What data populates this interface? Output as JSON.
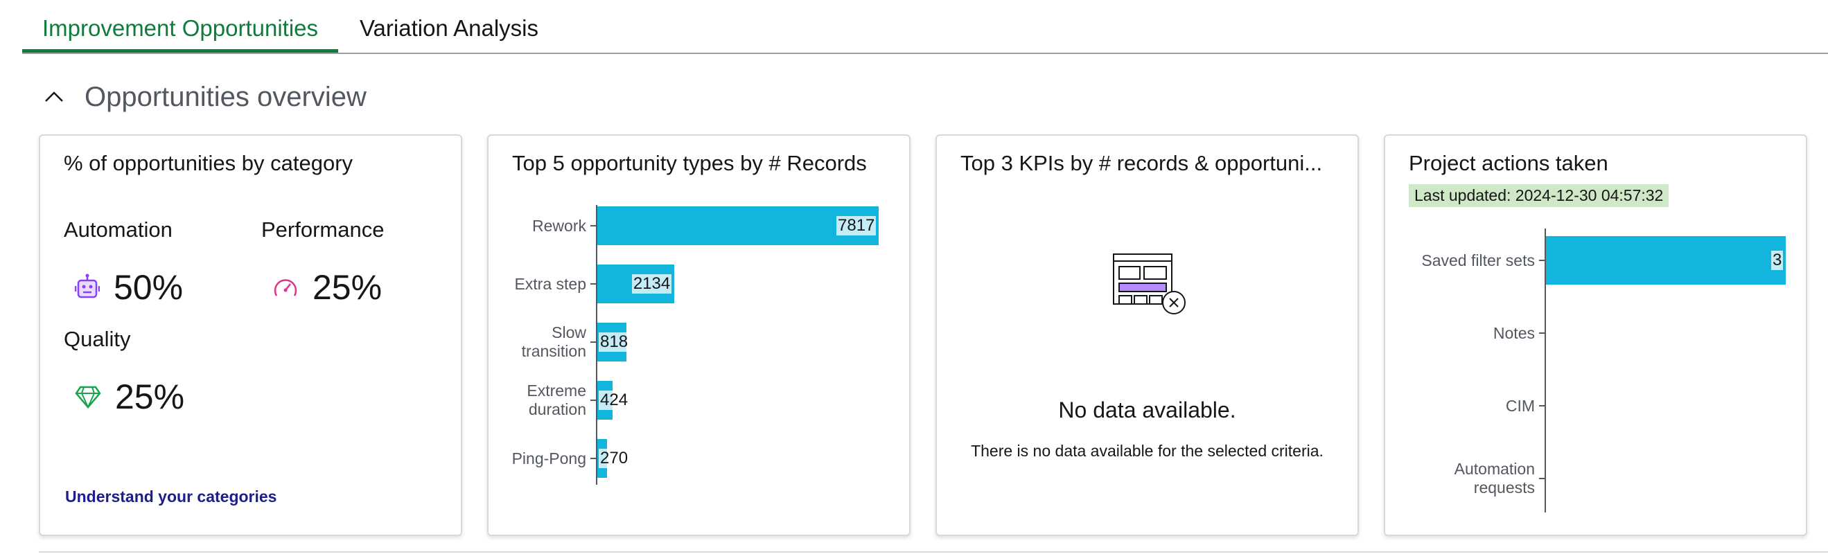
{
  "tabs": [
    {
      "label": "Improvement Opportunities",
      "active": true
    },
    {
      "label": "Variation Analysis",
      "active": false
    }
  ],
  "section": {
    "title": "Opportunities overview",
    "icon": "chevron-up-icon"
  },
  "colors": {
    "accent": "#0e7c3a",
    "bar": "#12b5dc",
    "automation": "#8a3ffc",
    "performance": "#e0358f",
    "quality": "#16a34a",
    "link": "#1d1d8e",
    "badge_bg": "#cfe8c7"
  },
  "card_categories": {
    "title": "% of opportunities by category",
    "categories": [
      {
        "name": "Automation",
        "value": "50%",
        "icon": "robot-icon"
      },
      {
        "name": "Performance",
        "value": "25%",
        "icon": "speedometer-icon"
      },
      {
        "name": "Quality",
        "value": "25%",
        "icon": "diamond-icon"
      }
    ],
    "link": "Understand your categories"
  },
  "card_top5": {
    "title": "Top 5 opportunity types by # Records",
    "chart_data": {
      "type": "bar",
      "orientation": "horizontal",
      "categories": [
        "Rework",
        "Extra step",
        "Slow transition",
        "Extreme duration",
        "Ping-Pong"
      ],
      "category_lines": [
        [
          "Rework"
        ],
        [
          "Extra step"
        ],
        [
          "Slow",
          "transition"
        ],
        [
          "Extreme",
          "duration"
        ],
        [
          "Ping-Pong"
        ]
      ],
      "values": [
        7817,
        2134,
        818,
        424,
        270
      ],
      "value_labels": [
        "7817",
        "2134",
        "818",
        "424",
        "270"
      ],
      "xlim": [
        0,
        7817
      ]
    }
  },
  "card_kpis": {
    "title": "Top 3 KPIs by # records & opportuni...",
    "empty_icon": "no-data-table-icon",
    "empty_title": "No data available.",
    "empty_text": "There is no data available for the selected criteria."
  },
  "card_actions": {
    "title": "Project actions taken",
    "last_updated": "Last updated: 2024-12-30 04:57:32",
    "chart_data": {
      "type": "bar",
      "orientation": "horizontal",
      "categories": [
        "Saved filter sets",
        "Notes",
        "CIM",
        "Automation requests"
      ],
      "category_lines": [
        [
          "Saved filter sets"
        ],
        [
          "Notes"
        ],
        [
          "CIM"
        ],
        [
          "Automation",
          "requests"
        ]
      ],
      "values": [
        3,
        0,
        0,
        0
      ],
      "value_labels": [
        "3",
        "",
        "",
        ""
      ],
      "xlim": [
        0,
        3
      ]
    }
  }
}
